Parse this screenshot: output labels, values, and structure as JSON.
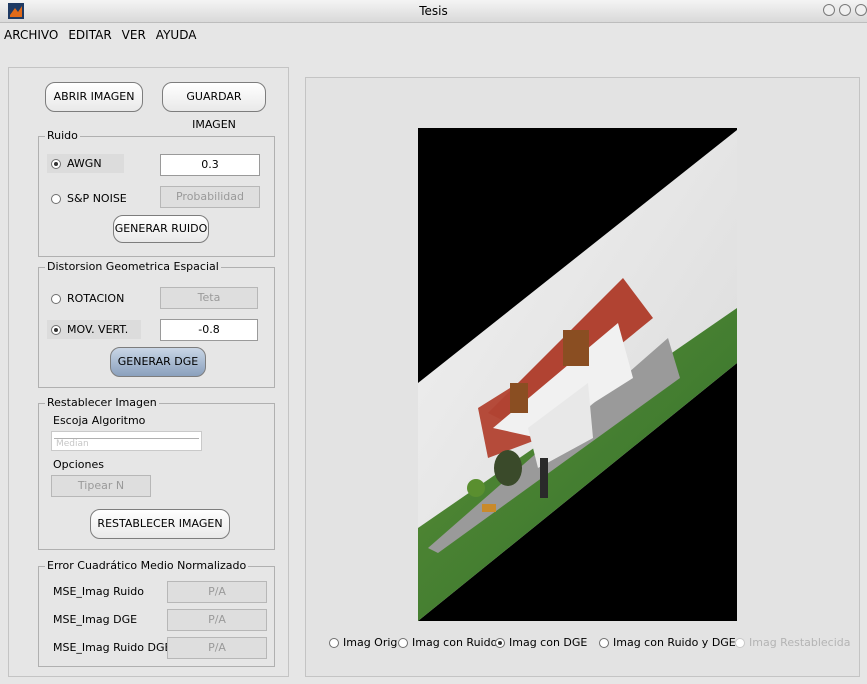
{
  "window": {
    "title": "Tesis"
  },
  "menu": [
    "ARCHIVO",
    "EDITAR",
    "VER",
    "AYUDA"
  ],
  "buttons": {
    "open": "ABRIR IMAGEN",
    "save": "GUARDAR IMAGEN",
    "noise": "GENERAR RUIDO",
    "dge": "GENERAR DGE",
    "restore": "RESTABLECER IMAGEN"
  },
  "noise": {
    "title": "Ruido",
    "awgn_label": "AWGN",
    "awgn_value": "0.3",
    "sp_label": "S&P NOISE",
    "sp_placeholder": "Probabilidad"
  },
  "dge": {
    "title": "Distorsion Geometrica Espacial",
    "rot_label": "ROTACION",
    "rot_placeholder": "Teta",
    "mov_label": "MOV. VERT.",
    "mov_value": "-0.8"
  },
  "restore": {
    "title": "Restablecer Imagen",
    "algo_label": "Escoja Algoritmo",
    "algo_selected": "Median",
    "options_label": "Opciones",
    "n_placeholder": "Tipear N"
  },
  "mse": {
    "title": "Error Cuadrático Medio Normalizado",
    "rows": [
      {
        "label": "MSE_Imag Ruido",
        "value": "P/A"
      },
      {
        "label": "MSE_Imag DGE",
        "value": "P/A"
      },
      {
        "label": "MSE_Imag Ruido DGE",
        "value": "P/A"
      }
    ]
  },
  "view_options": [
    {
      "label": "Imag Orig",
      "checked": false,
      "enabled": true
    },
    {
      "label": "Imag con Ruido",
      "checked": false,
      "enabled": true
    },
    {
      "label": "Imag con DGE",
      "checked": true,
      "enabled": true
    },
    {
      "label": "Imag con Ruido y DGE",
      "checked": false,
      "enabled": true
    },
    {
      "label": "Imag Restablecida",
      "checked": false,
      "enabled": false
    }
  ]
}
